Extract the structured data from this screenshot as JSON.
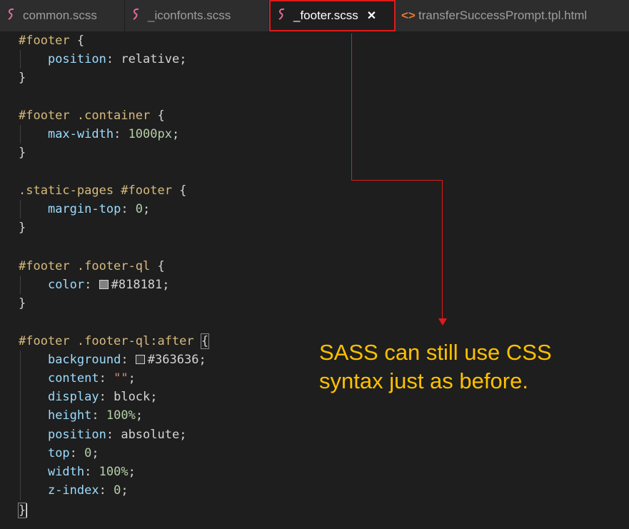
{
  "tabs": [
    {
      "icon": "sass-icon",
      "label": "common.scss",
      "active": false
    },
    {
      "icon": "sass-icon",
      "label": "_iconfonts.scss",
      "active": false
    },
    {
      "icon": "sass-icon",
      "label": "_footer.scss",
      "active": true,
      "close": "✕"
    },
    {
      "icon": "html-icon",
      "label": "transferSuccessPrompt.tpl.html",
      "active": false
    }
  ],
  "code": {
    "r1_sel": "#footer",
    "r1_p1": "position",
    "r1_v1": "relative",
    "r2_sel": "#footer .container",
    "r2_p1": "max-width",
    "r2_v1": "1000px",
    "r3_sel": ".static-pages #footer",
    "r3_p1": "margin-top",
    "r3_v1": "0",
    "r4_sel": "#footer .footer-ql",
    "r4_p1": "color",
    "r4_v1": "#818181",
    "r5_sel": "#footer .footer-ql:after",
    "r5_p1": "background",
    "r5_v1": "#363636",
    "r5_p2": "content",
    "r5_v2": "\"\"",
    "r5_p3": "display",
    "r5_v3": "block",
    "r5_p4": "height",
    "r5_v4": "100%",
    "r5_p5": "position",
    "r5_v5": "absolute",
    "r5_p6": "top",
    "r5_v6": "0",
    "r5_p7": "width",
    "r5_v7": "100%",
    "r5_p8": "z-index",
    "r5_v8": "0"
  },
  "swatch_colors": {
    "r4": "#818181",
    "r5": "#363636"
  },
  "annotation": {
    "line1": "SASS can still use CSS",
    "line2": "syntax just as before.",
    "color": "#ffc000",
    "arrow_color": "#e01a1a"
  }
}
